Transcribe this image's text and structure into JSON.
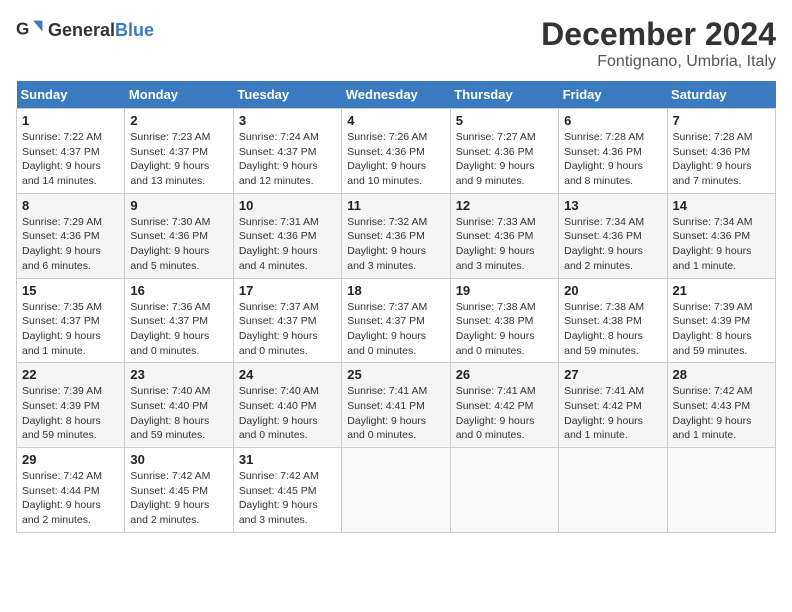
{
  "logo": {
    "text_general": "General",
    "text_blue": "Blue"
  },
  "title": "December 2024",
  "location": "Fontignano, Umbria, Italy",
  "days_of_week": [
    "Sunday",
    "Monday",
    "Tuesday",
    "Wednesday",
    "Thursday",
    "Friday",
    "Saturday"
  ],
  "weeks": [
    [
      {
        "day": "1",
        "sunrise": "Sunrise: 7:22 AM",
        "sunset": "Sunset: 4:37 PM",
        "daylight": "Daylight: 9 hours and 14 minutes."
      },
      {
        "day": "2",
        "sunrise": "Sunrise: 7:23 AM",
        "sunset": "Sunset: 4:37 PM",
        "daylight": "Daylight: 9 hours and 13 minutes."
      },
      {
        "day": "3",
        "sunrise": "Sunrise: 7:24 AM",
        "sunset": "Sunset: 4:37 PM",
        "daylight": "Daylight: 9 hours and 12 minutes."
      },
      {
        "day": "4",
        "sunrise": "Sunrise: 7:26 AM",
        "sunset": "Sunset: 4:36 PM",
        "daylight": "Daylight: 9 hours and 10 minutes."
      },
      {
        "day": "5",
        "sunrise": "Sunrise: 7:27 AM",
        "sunset": "Sunset: 4:36 PM",
        "daylight": "Daylight: 9 hours and 9 minutes."
      },
      {
        "day": "6",
        "sunrise": "Sunrise: 7:28 AM",
        "sunset": "Sunset: 4:36 PM",
        "daylight": "Daylight: 9 hours and 8 minutes."
      },
      {
        "day": "7",
        "sunrise": "Sunrise: 7:28 AM",
        "sunset": "Sunset: 4:36 PM",
        "daylight": "Daylight: 9 hours and 7 minutes."
      }
    ],
    [
      {
        "day": "8",
        "sunrise": "Sunrise: 7:29 AM",
        "sunset": "Sunset: 4:36 PM",
        "daylight": "Daylight: 9 hours and 6 minutes."
      },
      {
        "day": "9",
        "sunrise": "Sunrise: 7:30 AM",
        "sunset": "Sunset: 4:36 PM",
        "daylight": "Daylight: 9 hours and 5 minutes."
      },
      {
        "day": "10",
        "sunrise": "Sunrise: 7:31 AM",
        "sunset": "Sunset: 4:36 PM",
        "daylight": "Daylight: 9 hours and 4 minutes."
      },
      {
        "day": "11",
        "sunrise": "Sunrise: 7:32 AM",
        "sunset": "Sunset: 4:36 PM",
        "daylight": "Daylight: 9 hours and 3 minutes."
      },
      {
        "day": "12",
        "sunrise": "Sunrise: 7:33 AM",
        "sunset": "Sunset: 4:36 PM",
        "daylight": "Daylight: 9 hours and 3 minutes."
      },
      {
        "day": "13",
        "sunrise": "Sunrise: 7:34 AM",
        "sunset": "Sunset: 4:36 PM",
        "daylight": "Daylight: 9 hours and 2 minutes."
      },
      {
        "day": "14",
        "sunrise": "Sunrise: 7:34 AM",
        "sunset": "Sunset: 4:36 PM",
        "daylight": "Daylight: 9 hours and 1 minute."
      }
    ],
    [
      {
        "day": "15",
        "sunrise": "Sunrise: 7:35 AM",
        "sunset": "Sunset: 4:37 PM",
        "daylight": "Daylight: 9 hours and 1 minute."
      },
      {
        "day": "16",
        "sunrise": "Sunrise: 7:36 AM",
        "sunset": "Sunset: 4:37 PM",
        "daylight": "Daylight: 9 hours and 0 minutes."
      },
      {
        "day": "17",
        "sunrise": "Sunrise: 7:37 AM",
        "sunset": "Sunset: 4:37 PM",
        "daylight": "Daylight: 9 hours and 0 minutes."
      },
      {
        "day": "18",
        "sunrise": "Sunrise: 7:37 AM",
        "sunset": "Sunset: 4:37 PM",
        "daylight": "Daylight: 9 hours and 0 minutes."
      },
      {
        "day": "19",
        "sunrise": "Sunrise: 7:38 AM",
        "sunset": "Sunset: 4:38 PM",
        "daylight": "Daylight: 9 hours and 0 minutes."
      },
      {
        "day": "20",
        "sunrise": "Sunrise: 7:38 AM",
        "sunset": "Sunset: 4:38 PM",
        "daylight": "Daylight: 8 hours and 59 minutes."
      },
      {
        "day": "21",
        "sunrise": "Sunrise: 7:39 AM",
        "sunset": "Sunset: 4:39 PM",
        "daylight": "Daylight: 8 hours and 59 minutes."
      }
    ],
    [
      {
        "day": "22",
        "sunrise": "Sunrise: 7:39 AM",
        "sunset": "Sunset: 4:39 PM",
        "daylight": "Daylight: 8 hours and 59 minutes."
      },
      {
        "day": "23",
        "sunrise": "Sunrise: 7:40 AM",
        "sunset": "Sunset: 4:40 PM",
        "daylight": "Daylight: 8 hours and 59 minutes."
      },
      {
        "day": "24",
        "sunrise": "Sunrise: 7:40 AM",
        "sunset": "Sunset: 4:40 PM",
        "daylight": "Daylight: 9 hours and 0 minutes."
      },
      {
        "day": "25",
        "sunrise": "Sunrise: 7:41 AM",
        "sunset": "Sunset: 4:41 PM",
        "daylight": "Daylight: 9 hours and 0 minutes."
      },
      {
        "day": "26",
        "sunrise": "Sunrise: 7:41 AM",
        "sunset": "Sunset: 4:42 PM",
        "daylight": "Daylight: 9 hours and 0 minutes."
      },
      {
        "day": "27",
        "sunrise": "Sunrise: 7:41 AM",
        "sunset": "Sunset: 4:42 PM",
        "daylight": "Daylight: 9 hours and 1 minute."
      },
      {
        "day": "28",
        "sunrise": "Sunrise: 7:42 AM",
        "sunset": "Sunset: 4:43 PM",
        "daylight": "Daylight: 9 hours and 1 minute."
      }
    ],
    [
      {
        "day": "29",
        "sunrise": "Sunrise: 7:42 AM",
        "sunset": "Sunset: 4:44 PM",
        "daylight": "Daylight: 9 hours and 2 minutes."
      },
      {
        "day": "30",
        "sunrise": "Sunrise: 7:42 AM",
        "sunset": "Sunset: 4:45 PM",
        "daylight": "Daylight: 9 hours and 2 minutes."
      },
      {
        "day": "31",
        "sunrise": "Sunrise: 7:42 AM",
        "sunset": "Sunset: 4:45 PM",
        "daylight": "Daylight: 9 hours and 3 minutes."
      },
      null,
      null,
      null,
      null
    ]
  ]
}
